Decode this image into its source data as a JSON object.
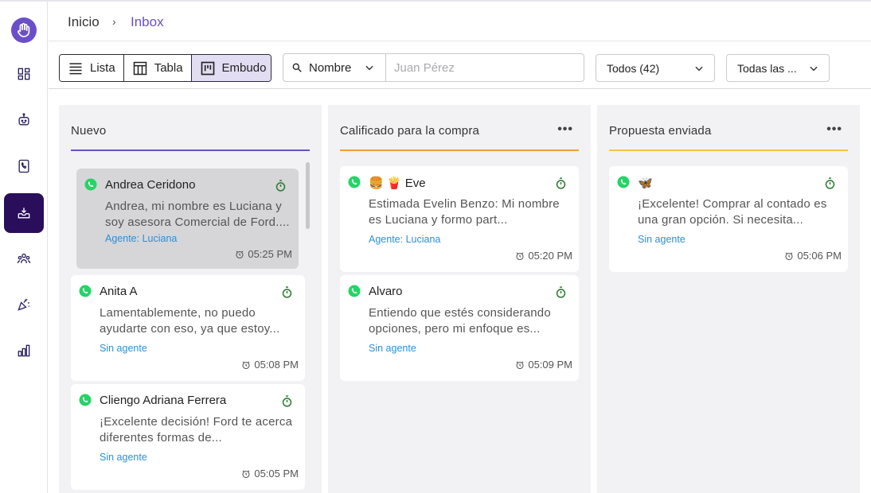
{
  "breadcrumb": {
    "home": "Inicio",
    "separator": "›",
    "current": "Inbox"
  },
  "views": [
    {
      "label": "Lista",
      "icon": "list-icon"
    },
    {
      "label": "Tabla",
      "icon": "table-icon"
    },
    {
      "label": "Embudo",
      "icon": "kanban-icon",
      "active": true
    }
  ],
  "search": {
    "field": "Nombre",
    "placeholder": "Juan Pérez"
  },
  "filters": {
    "status": "Todos (42)",
    "other": "Todas las ..."
  },
  "colors": {
    "accent": "#6a4fc8",
    "sidebar_active": "#2a0e5c",
    "col1_line": "#6a4fc8",
    "col2_line": "#f0a030",
    "col3_line": "#f2c640",
    "whatsapp": "#25d366",
    "timer": "#2e7d32",
    "agent_link": "#2d8fd5"
  },
  "columns": [
    {
      "title": "Nuevo",
      "cards": [
        {
          "name": "Andrea Ceridono",
          "message": "Andrea, mi nombre es Luciana y soy asesora Comercial de Ford....",
          "agent": "Agente: Luciana",
          "time": "05:25 PM",
          "selected": true
        },
        {
          "name": "Anita A",
          "message": "Lamentablemente, no puedo ayudarte con eso, ya que estoy...",
          "agent": "Sin agente",
          "time": "05:08 PM"
        },
        {
          "name": "Cliengo Adriana Ferrera",
          "message": "¡Excelente decisión! Ford te acerca diferentes formas de...",
          "agent": "Sin agente",
          "time": "05:05 PM"
        }
      ]
    },
    {
      "title": "Calificado para la compra",
      "more": "•••",
      "cards": [
        {
          "name": "🍔 🍟 Eve",
          "message": "Estimada Evelin Benzo: Mi nombre es Luciana y formo part...",
          "agent": "Agente: Luciana",
          "time": "05:20 PM"
        },
        {
          "name": "Alvaro",
          "message": "Entiendo que estés considerando opciones, pero mi enfoque es...",
          "agent": "Sin agente",
          "time": "05:09 PM"
        }
      ]
    },
    {
      "title": "Propuesta enviada",
      "more": "•••",
      "cards": [
        {
          "name": "🦋",
          "message": "¡Excelente! Comprar al contado es una gran opción. Si necesita...",
          "agent": "Sin agente",
          "time": "05:06 PM"
        }
      ]
    }
  ]
}
